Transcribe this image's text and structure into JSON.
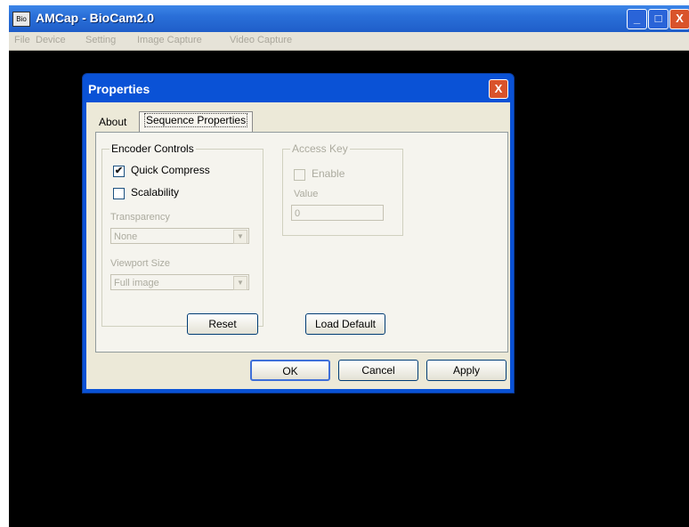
{
  "app": {
    "icon_text": "Bio",
    "title": "AMCap - BioCam2.0",
    "controls": {
      "minimize": "_",
      "maximize": "□",
      "close": "X"
    },
    "menu": [
      "File",
      "Device",
      "Setting",
      "Image Capture",
      "Video Capture"
    ]
  },
  "dialog": {
    "title": "Properties",
    "close": "X",
    "tabs": [
      {
        "label": "About"
      },
      {
        "label": "Sequence Properties",
        "selected": true
      }
    ],
    "encoder_controls": {
      "title": "Encoder Controls",
      "quick_compress": {
        "label": "Quick Compress",
        "checked": true
      },
      "scalability": {
        "label": "Scalability",
        "checked": false
      },
      "transparency": {
        "label": "Transparency",
        "value": "None"
      },
      "viewport_size": {
        "label": "Viewport Size",
        "value": "Full image"
      }
    },
    "access_key": {
      "title": "Access Key",
      "enable": {
        "label": "Enable",
        "checked": false
      },
      "value_label": "Value",
      "value": "0"
    },
    "buttons": {
      "reset": "Reset",
      "load_default": "Load Default",
      "ok": "OK",
      "cancel": "Cancel",
      "apply": "Apply"
    }
  },
  "colors": {
    "titlebar": "#2a6fd8",
    "dialog_frame": "#0a52d6",
    "close_button": "#d9532b",
    "dialog_face": "#ece9d8",
    "client_area": "#000000"
  }
}
